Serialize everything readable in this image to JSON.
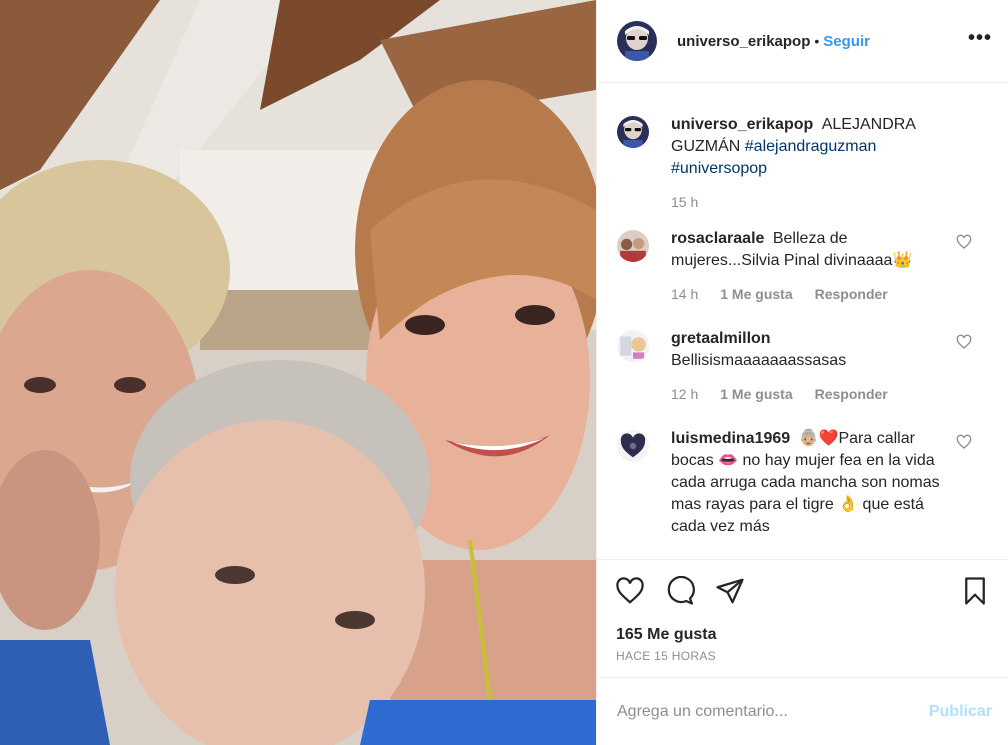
{
  "post": {
    "username": "universo_erikapop",
    "separator": "•",
    "follow_label": "Seguir",
    "more_label": "•••",
    "photo_alt": "photo-of-three-women"
  },
  "caption": {
    "username": "universo_erikapop",
    "text": "ALEJANDRA GUZMÁN",
    "tags": [
      "#alejandraguzman",
      "#universopop"
    ],
    "time": "15 h"
  },
  "comments": [
    {
      "username": "rosaclaraale",
      "text": "Belleza de mujeres...Silvia Pinal divinaaaa👑",
      "time": "14 h",
      "likes": "1 Me gusta",
      "reply": "Responder"
    },
    {
      "username": "gretaalmillon",
      "text": "Bellisismaaaaaaassasas",
      "time": "12 h",
      "likes": "1 Me gusta",
      "reply": "Responder"
    },
    {
      "username": "luismedina1969",
      "text": "👵🏼❤️Para callar bocas 👄 no hay mujer fea en la vida cada arruga cada mancha son nomas mas rayas para el tigre 👌 que está cada vez más"
    }
  ],
  "actions": {
    "likes_count": "165 Me gusta",
    "timestamp": "HACE 15 HORAS",
    "comment_placeholder": "Agrega un comentario...",
    "publish_label": "Publicar"
  },
  "colors": {
    "link": "#3897f0",
    "hashtag": "#003569",
    "muted": "#8e8e8e",
    "publish_disabled": "#b2dffc"
  }
}
